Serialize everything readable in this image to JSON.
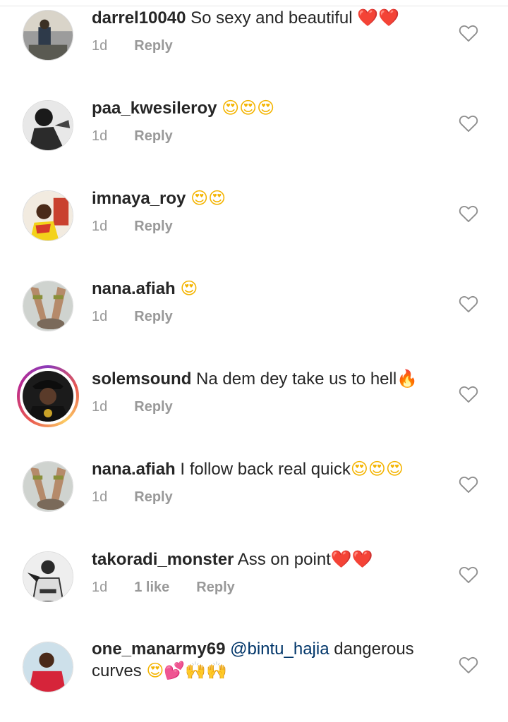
{
  "comments": [
    {
      "username": "darrel10040",
      "text": " So sexy and beautiful ",
      "emoji": "❤️❤️",
      "emoji_class": "heart-emoji",
      "time": "1d",
      "likes": "",
      "reply": "Reply"
    },
    {
      "username": "paa_kwesileroy",
      "text": " ",
      "emoji": "😍😍😍",
      "emoji_class": "face-emoji",
      "time": "1d",
      "likes": "",
      "reply": "Reply"
    },
    {
      "username": "imnaya_roy",
      "text": " ",
      "emoji": "😍😍",
      "emoji_class": "face-emoji",
      "time": "1d",
      "likes": "",
      "reply": "Reply"
    },
    {
      "username": "nana.afiah",
      "text": " ",
      "emoji": "😍",
      "emoji_class": "face-emoji",
      "time": "1d",
      "likes": "",
      "reply": "Reply"
    },
    {
      "username": "solemsound",
      "text": " Na dem dey take us to hell",
      "emoji": "🔥",
      "emoji_class": "fire-emoji",
      "time": "1d",
      "likes": "",
      "reply": "Reply"
    },
    {
      "username": "nana.afiah",
      "text": " I follow back real quick",
      "emoji": "😍😍😍",
      "emoji_class": "face-emoji",
      "time": "1d",
      "likes": "",
      "reply": "Reply"
    },
    {
      "username": "takoradi_monster",
      "text": " Ass on point",
      "emoji": "❤️❤️",
      "emoji_class": "heart-emoji",
      "time": "1d",
      "likes": "1 like",
      "reply": "Reply"
    },
    {
      "username": "one_manarmy69",
      "mention": "@bintu_hajia",
      "text": " dangerous curves ",
      "emoji": "😍💕🙌🙌",
      "emoji_class": "face-emoji",
      "time": "",
      "likes": "",
      "reply": ""
    }
  ],
  "icons": {
    "like": "heart-outline-icon"
  },
  "colors": {
    "text": "#262626",
    "meta": "#999999",
    "mention": "#003569",
    "heart": "#e0202e"
  }
}
